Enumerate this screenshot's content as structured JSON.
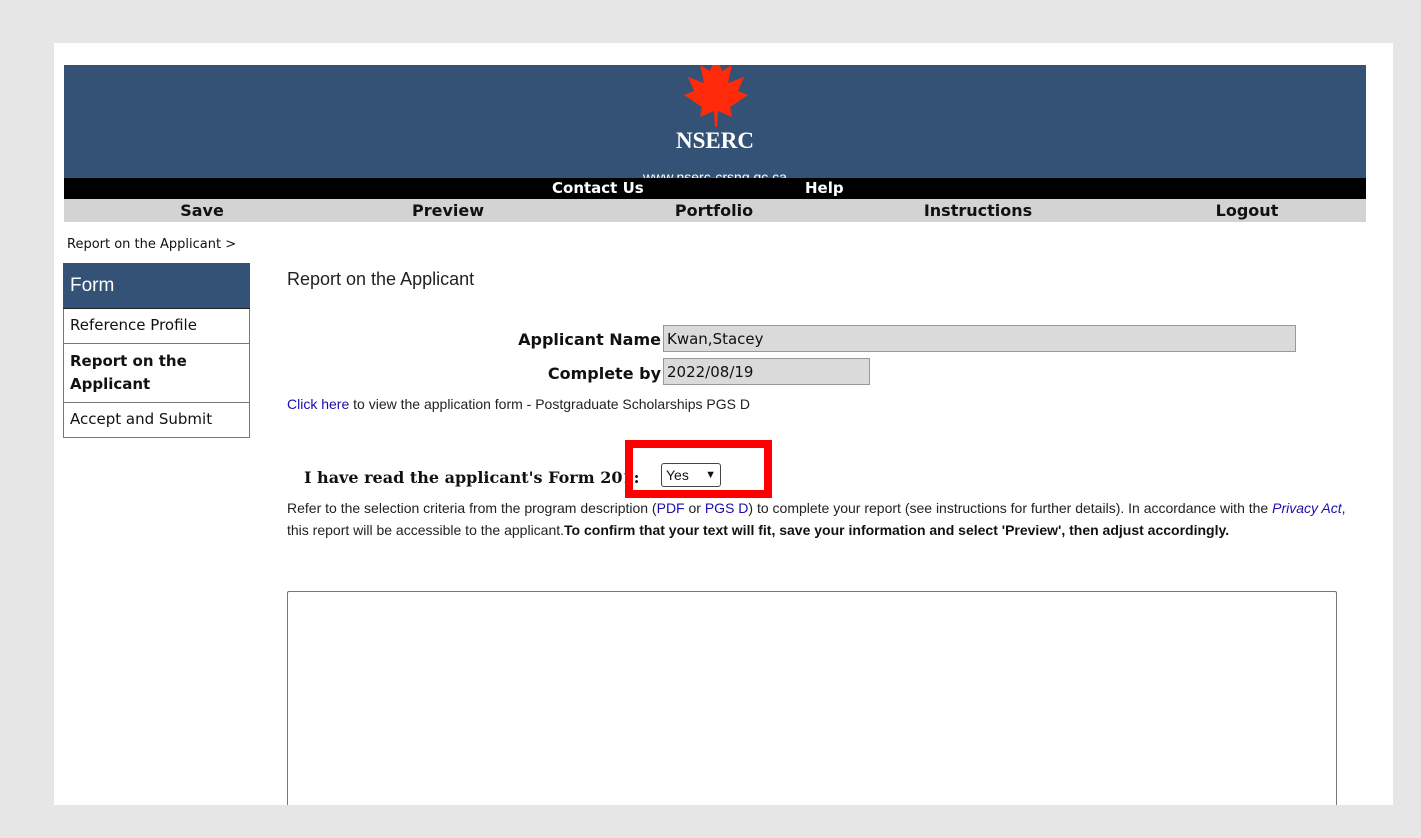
{
  "header": {
    "brand": "NSERC",
    "url": "www.nserc-crsng.gc.ca",
    "colors": {
      "banner": "#345276",
      "leaf": "#ff2a0a"
    }
  },
  "topbar": {
    "contact": "Contact Us",
    "help": "Help"
  },
  "menu": {
    "save": "Save",
    "preview": "Preview",
    "portfolio": "Portfolio",
    "instructions": "Instructions",
    "logout": "Logout"
  },
  "breadcrumb": "Report on the Applicant >",
  "sidebar": {
    "title": "Form",
    "items": [
      {
        "label": "Reference Profile"
      },
      {
        "label": "Report on the Applicant"
      },
      {
        "label": "Accept and Submit"
      }
    ]
  },
  "main": {
    "title": "Report on the Applicant",
    "applicant_label": "Applicant Name",
    "applicant_value": "Kwan,Stacey",
    "complete_label": "Complete by",
    "complete_value": "2022/08/19",
    "click_here": "Click here",
    "click_rest": "to view the application form - Postgraduate Scholarships PGS D",
    "form201_label": "I have read the applicant's Form 201:",
    "form201_value": "Yes",
    "para_1": "Refer to the selection criteria from the program description (",
    "para_pdf": "PDF",
    "para_or": " or ",
    "para_pgsd": "PGS D",
    "para_2": ") to complete your report (see instructions for further details). In accordance with the ",
    "para_privacy": "Privacy Act",
    "para_3": ", this report will be accessible to the applicant.",
    "para_bold": "To confirm that your text will fit, save your information and select 'Preview', then adjust accordingly."
  }
}
